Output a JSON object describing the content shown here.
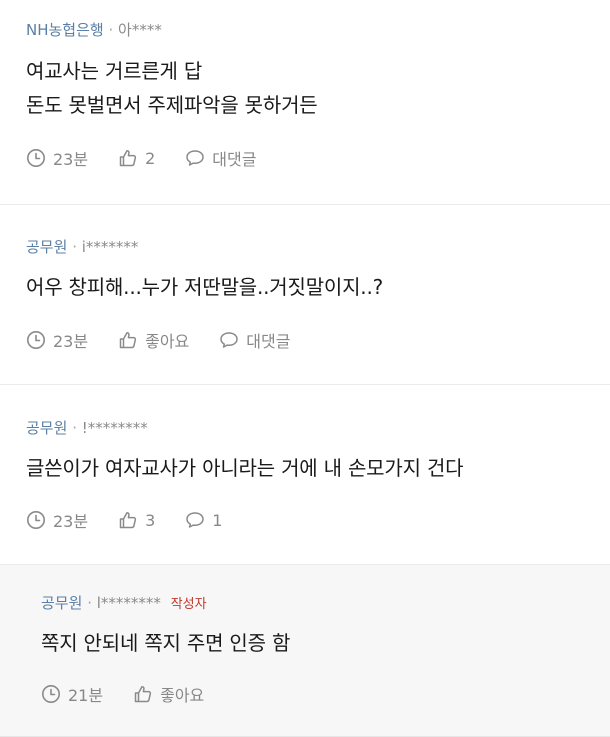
{
  "comments": [
    {
      "company": "NH농협은행",
      "separator": "·",
      "nickname": "아****",
      "lines": [
        "여교사는 거르른게 답",
        "돈도 못벌면서 주제파악을 못하거든"
      ],
      "time": "23분",
      "like_label": "2",
      "reply_label": "대댓글"
    },
    {
      "company": "공무원",
      "separator": "·",
      "nickname": "i*******",
      "lines": [
        "어우 창피해...누가 저딴말을..거짓말이지..?"
      ],
      "time": "23분",
      "like_label": "좋아요",
      "reply_label": "대댓글"
    },
    {
      "company": "공무원",
      "separator": "·",
      "nickname": "!********",
      "lines": [
        "글쓴이가 여자교사가 아니라는 거에 내 손모가지 건다"
      ],
      "time": "23분",
      "like_label": "3",
      "reply_label": "1"
    }
  ],
  "reply": {
    "company": "공무원",
    "separator": "·",
    "nickname": "l********",
    "author_badge": "작성자",
    "lines": [
      "쪽지 안되네 쪽지 주면 인증 함"
    ],
    "time": "21분",
    "like_label": "좋아요"
  },
  "colors": {
    "company": "#5c7fa5",
    "author_badge": "#c0392b",
    "reply_background": "#f7f7f7",
    "icon": "#8a8a8a"
  },
  "icons": {
    "time": "clock-icon",
    "like": "thumbs-up-icon",
    "reply": "speech-bubble-icon"
  }
}
